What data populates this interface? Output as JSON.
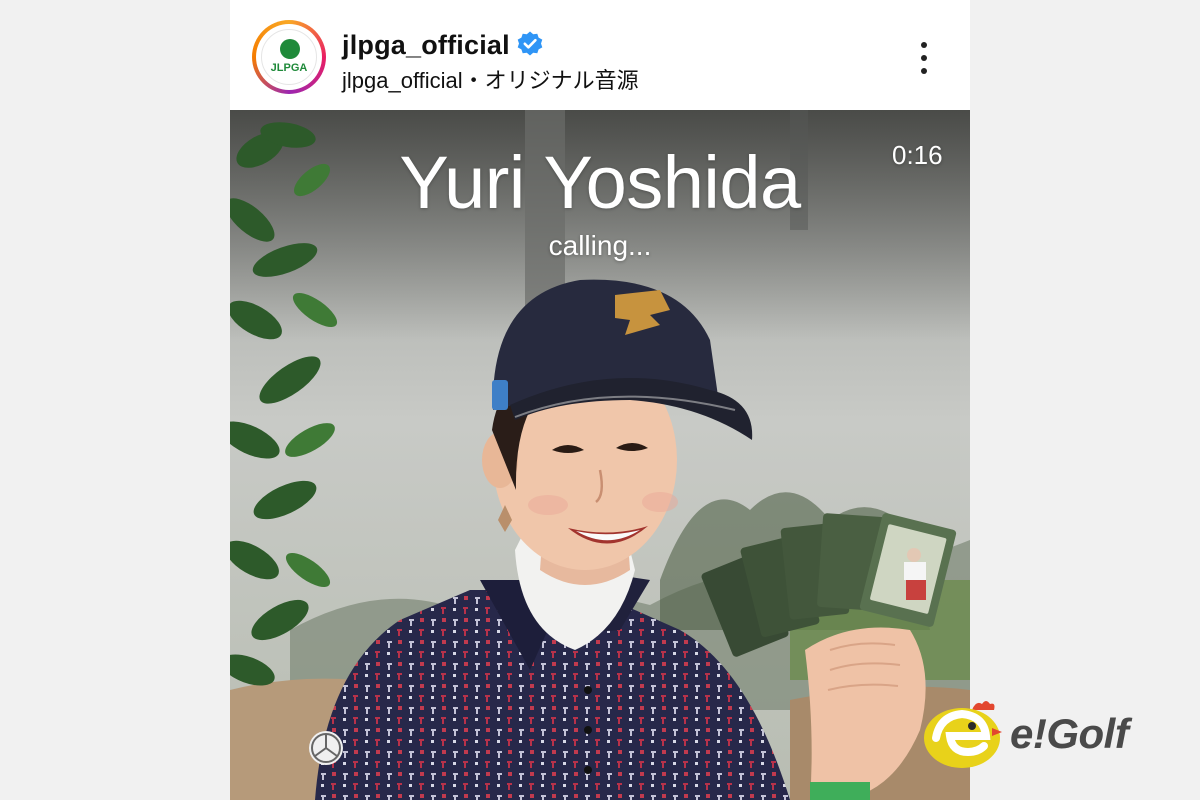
{
  "post": {
    "username": "jlpga_official",
    "subline": "jlpga_official・オリジナル音源",
    "avatar_text": "JLPGA",
    "verified_icon": "verified-badge-icon",
    "more_icon": "more-options-icon"
  },
  "call_overlay": {
    "caller_name": "Yuri Yoshida",
    "status": "calling...",
    "timer": "0:16"
  },
  "watermark": {
    "text": "e!Golf"
  },
  "colors": {
    "verified_blue": "#2f95f6",
    "jlpga_green": "#1f8a3a",
    "watermark_yellow": "#e8d21a"
  }
}
